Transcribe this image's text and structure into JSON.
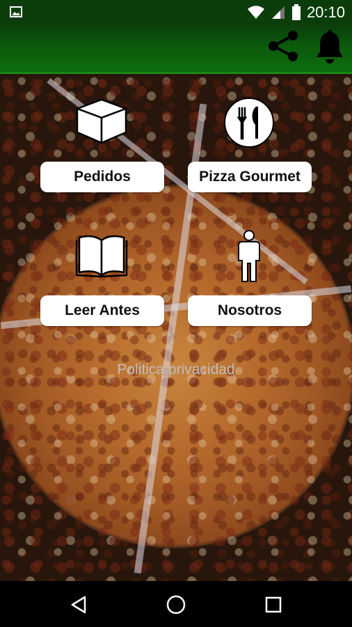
{
  "status_bar": {
    "time": "20:10",
    "icons": [
      "image-icon",
      "wifi-icon",
      "signal-icon",
      "battery-icon"
    ]
  },
  "app_bar": {
    "background_color": "#0c5a0c",
    "actions": [
      "share-icon",
      "bell-icon"
    ]
  },
  "menu": {
    "items": [
      {
        "label": "Pedidos",
        "icon": "box-icon"
      },
      {
        "label": "Pizza Gourmet",
        "icon": "cutlery-icon"
      },
      {
        "label": "Leer Antes",
        "icon": "book-icon"
      },
      {
        "label": "Nosotros",
        "icon": "person-icon"
      }
    ],
    "privacy_link": "Politica privacidad"
  },
  "nav_bar": {
    "buttons": [
      "back-icon",
      "home-icon",
      "recents-icon"
    ]
  }
}
